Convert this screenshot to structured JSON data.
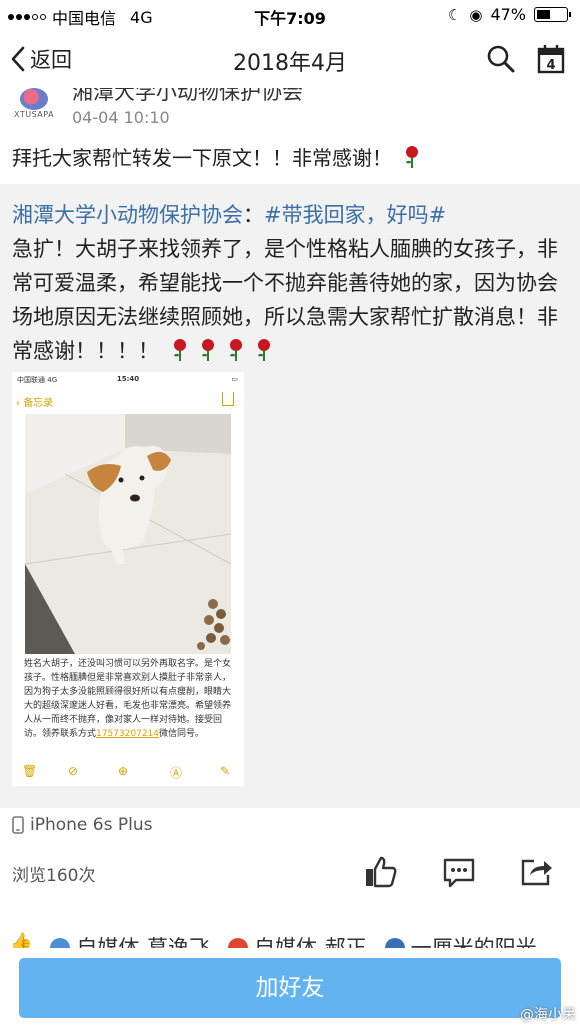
{
  "status_bar": {
    "carrier": "中国电信",
    "network": "4G",
    "time": "下午7:09",
    "battery": "47%",
    "battery_level": 0.47
  },
  "nav": {
    "back_label": "返回",
    "title": "2018年4月",
    "calendar_day": "4"
  },
  "post": {
    "author_name": "湘潭大学小动物保护协会",
    "avatar_text": "XTUSAPA",
    "time": "04-04 10:10",
    "text": "拜托大家帮忙转发一下原文！！非常感谢！"
  },
  "repost": {
    "author": "湘潭大学小动物保护协会",
    "separator": "：",
    "hashtag": "#带我回家，好吗#",
    "body": "急扩！大胡子来找领养了，是个性格粘人腼腆的女孩子，非常可爱温柔，希望能找一个不抛弃能善待她的家，因为协会场地原因无法继续照顾她，所以急需大家帮忙扩散消息！非常感谢！！！！"
  },
  "screenshot": {
    "carrier": "中国联通",
    "network": "4G",
    "time": "15:40",
    "back_label": "备忘录",
    "caption": "姓名大胡子，还没叫习惯可以另外再取名字。是个女孩子。性格腼腆但是非常喜欢别人摸肚子非常亲人，因为狗子太多没能照顾得很好所以有点瘦削，眼睛大大的超级深邃迷人好看，毛发也非常漂亮。希望领养人从一而终不抛弃，像对家人一样对待她。接受回访。领养联系方式",
    "phone": "17573207214",
    "caption_tail": "微信同号。"
  },
  "device": "iPhone 6s Plus",
  "stats": {
    "views": "浏览160次"
  },
  "likers": [
    "自媒体-葛逸飞",
    "自媒体-郝正",
    "一厘米的阳光"
  ],
  "colors": {
    "accent": "#62b3ef",
    "link": "#3b6fa8",
    "memo": "#d6a400"
  },
  "add_friend_label": "加好友",
  "watermark": "@海小呆"
}
